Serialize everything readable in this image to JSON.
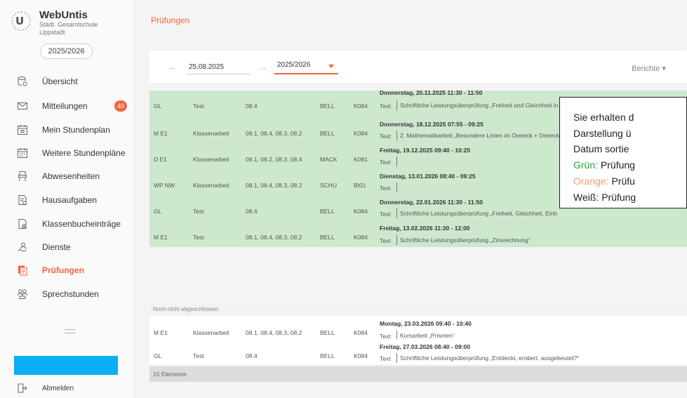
{
  "brand": {
    "name": "WebUntis",
    "school": "Städt. Gesamtschule Lippstadt",
    "school_year": "2025/2026"
  },
  "sidebar": {
    "items": [
      {
        "label": "Übersicht",
        "icon": "overview-icon"
      },
      {
        "label": "Mitteilungen",
        "icon": "mail-icon",
        "badge": "40"
      },
      {
        "label": "Mein Stundenplan",
        "icon": "calendar-icon"
      },
      {
        "label": "Weitere Stundenpläne",
        "icon": "calendar-grid-icon"
      },
      {
        "label": "Abwesenheiten",
        "icon": "absence-icon"
      },
      {
        "label": "Hausaufgaben",
        "icon": "homework-icon"
      },
      {
        "label": "Klassenbucheinträge",
        "icon": "classbook-icon"
      },
      {
        "label": "Dienste",
        "icon": "service-icon"
      },
      {
        "label": "Prüfungen",
        "icon": "exam-icon",
        "active": true
      },
      {
        "label": "Sprechstunden",
        "icon": "office-hours-icon"
      }
    ],
    "logout_label": "Abmelden"
  },
  "page": {
    "title": "Prüfungen"
  },
  "toolbar": {
    "date_value": "25.08.2025",
    "year_value": "2025/2026",
    "reports_label": "Berichte ▾"
  },
  "rows": [
    {
      "subject": "GL",
      "type": "Test",
      "classes": "08.4",
      "teacher": "BELL",
      "room": "K084",
      "date": "Donnerstag, 20.11.2025 11:30 - 11:50",
      "text_label": "Text",
      "text": "Schriftliche Leistungsüberprüfung „Freiheit und Gleichheit in",
      "color": "green"
    },
    {
      "subject": "M E1",
      "type": "Klassenarbeit",
      "classes": "08.1, 08.4, 08.3, 08.2",
      "teacher": "BELL",
      "room": "K084",
      "date": "Donnerstag, 18.12.2025 07:55 - 09:25",
      "text_label": "Text",
      "text": "2. Mathematikarbeit „Besondere Linien im Dreieck + Dreieck",
      "color": "green"
    },
    {
      "subject": "D E1",
      "type": "Klassenarbeit",
      "classes": "08.1, 08.2, 08.3, 08.4",
      "teacher": "MACK",
      "room": "K081",
      "date": "Freitag, 19.12.2025 09:40 - 10:25",
      "text_label": "Text",
      "text": "",
      "color": "green"
    },
    {
      "subject": "WP NW",
      "type": "Klassenarbeit",
      "classes": "08.1, 08.4, 08.3, 08.2",
      "teacher": "SCHU",
      "room": "BI01",
      "date": "Dienstag, 13.01.2026 08:40 - 09:25",
      "text_label": "Text",
      "text": "",
      "color": "green"
    },
    {
      "subject": "GL",
      "type": "Test",
      "classes": "08.4",
      "teacher": "BELL",
      "room": "K084",
      "date": "Donnerstag, 22.01.2026 11:30 - 11:50",
      "text_label": "Text",
      "text": "Schriftliche Leistungsüberprüfung „Freiheit, Gleichheit, Einh",
      "color": "green"
    },
    {
      "subject": "M E1",
      "type": "Test",
      "classes": "08.1, 08.4, 08.3, 08.2",
      "teacher": "BELL",
      "room": "K084",
      "date": "Freitag, 13.02.2026 11:30 - 12:00",
      "text_label": "Text",
      "text": "Schriftliche Leistungsüberprüfung „Zinsrechnung“",
      "color": "green"
    },
    {
      "subject": "M E1",
      "type": "Klassenarbeit",
      "classes": "08.1, 08.4, 08.3, 08.2",
      "teacher": "BELL",
      "room": "K084",
      "date": "Montag, 23.03.2026 09:40 - 10:40",
      "text_label": "Text",
      "text": "Kursarbeit „Prismen“",
      "color": "white"
    },
    {
      "subject": "GL",
      "type": "Test",
      "classes": "08.4",
      "teacher": "BELL",
      "room": "K084",
      "date": "Freitag, 27.03.2026 08:40 - 09:00",
      "text_label": "Text",
      "text": "Schriftliche Leistungsüberprüfung „Entdeckt, erobert, ausgebeutet?“",
      "color": "white"
    }
  ],
  "group_header": "Noch nicht abgeschlossen",
  "footer": "15 Elemente",
  "info_box": {
    "line1": "Sie erhalten d",
    "line2": "Darstellung ü",
    "line3": "Datum sortie",
    "line4_prefix": "Grün:",
    "line4_rest": " Prüfung",
    "line5_prefix": "Orange:",
    "line5_rest": " Prüfu",
    "line6": "Weiß: Prüfung"
  },
  "colors": {
    "accent": "#f0663a",
    "green_row": "#cde8cd",
    "badge": "#f0663a",
    "redacted": "#0aaef2"
  }
}
